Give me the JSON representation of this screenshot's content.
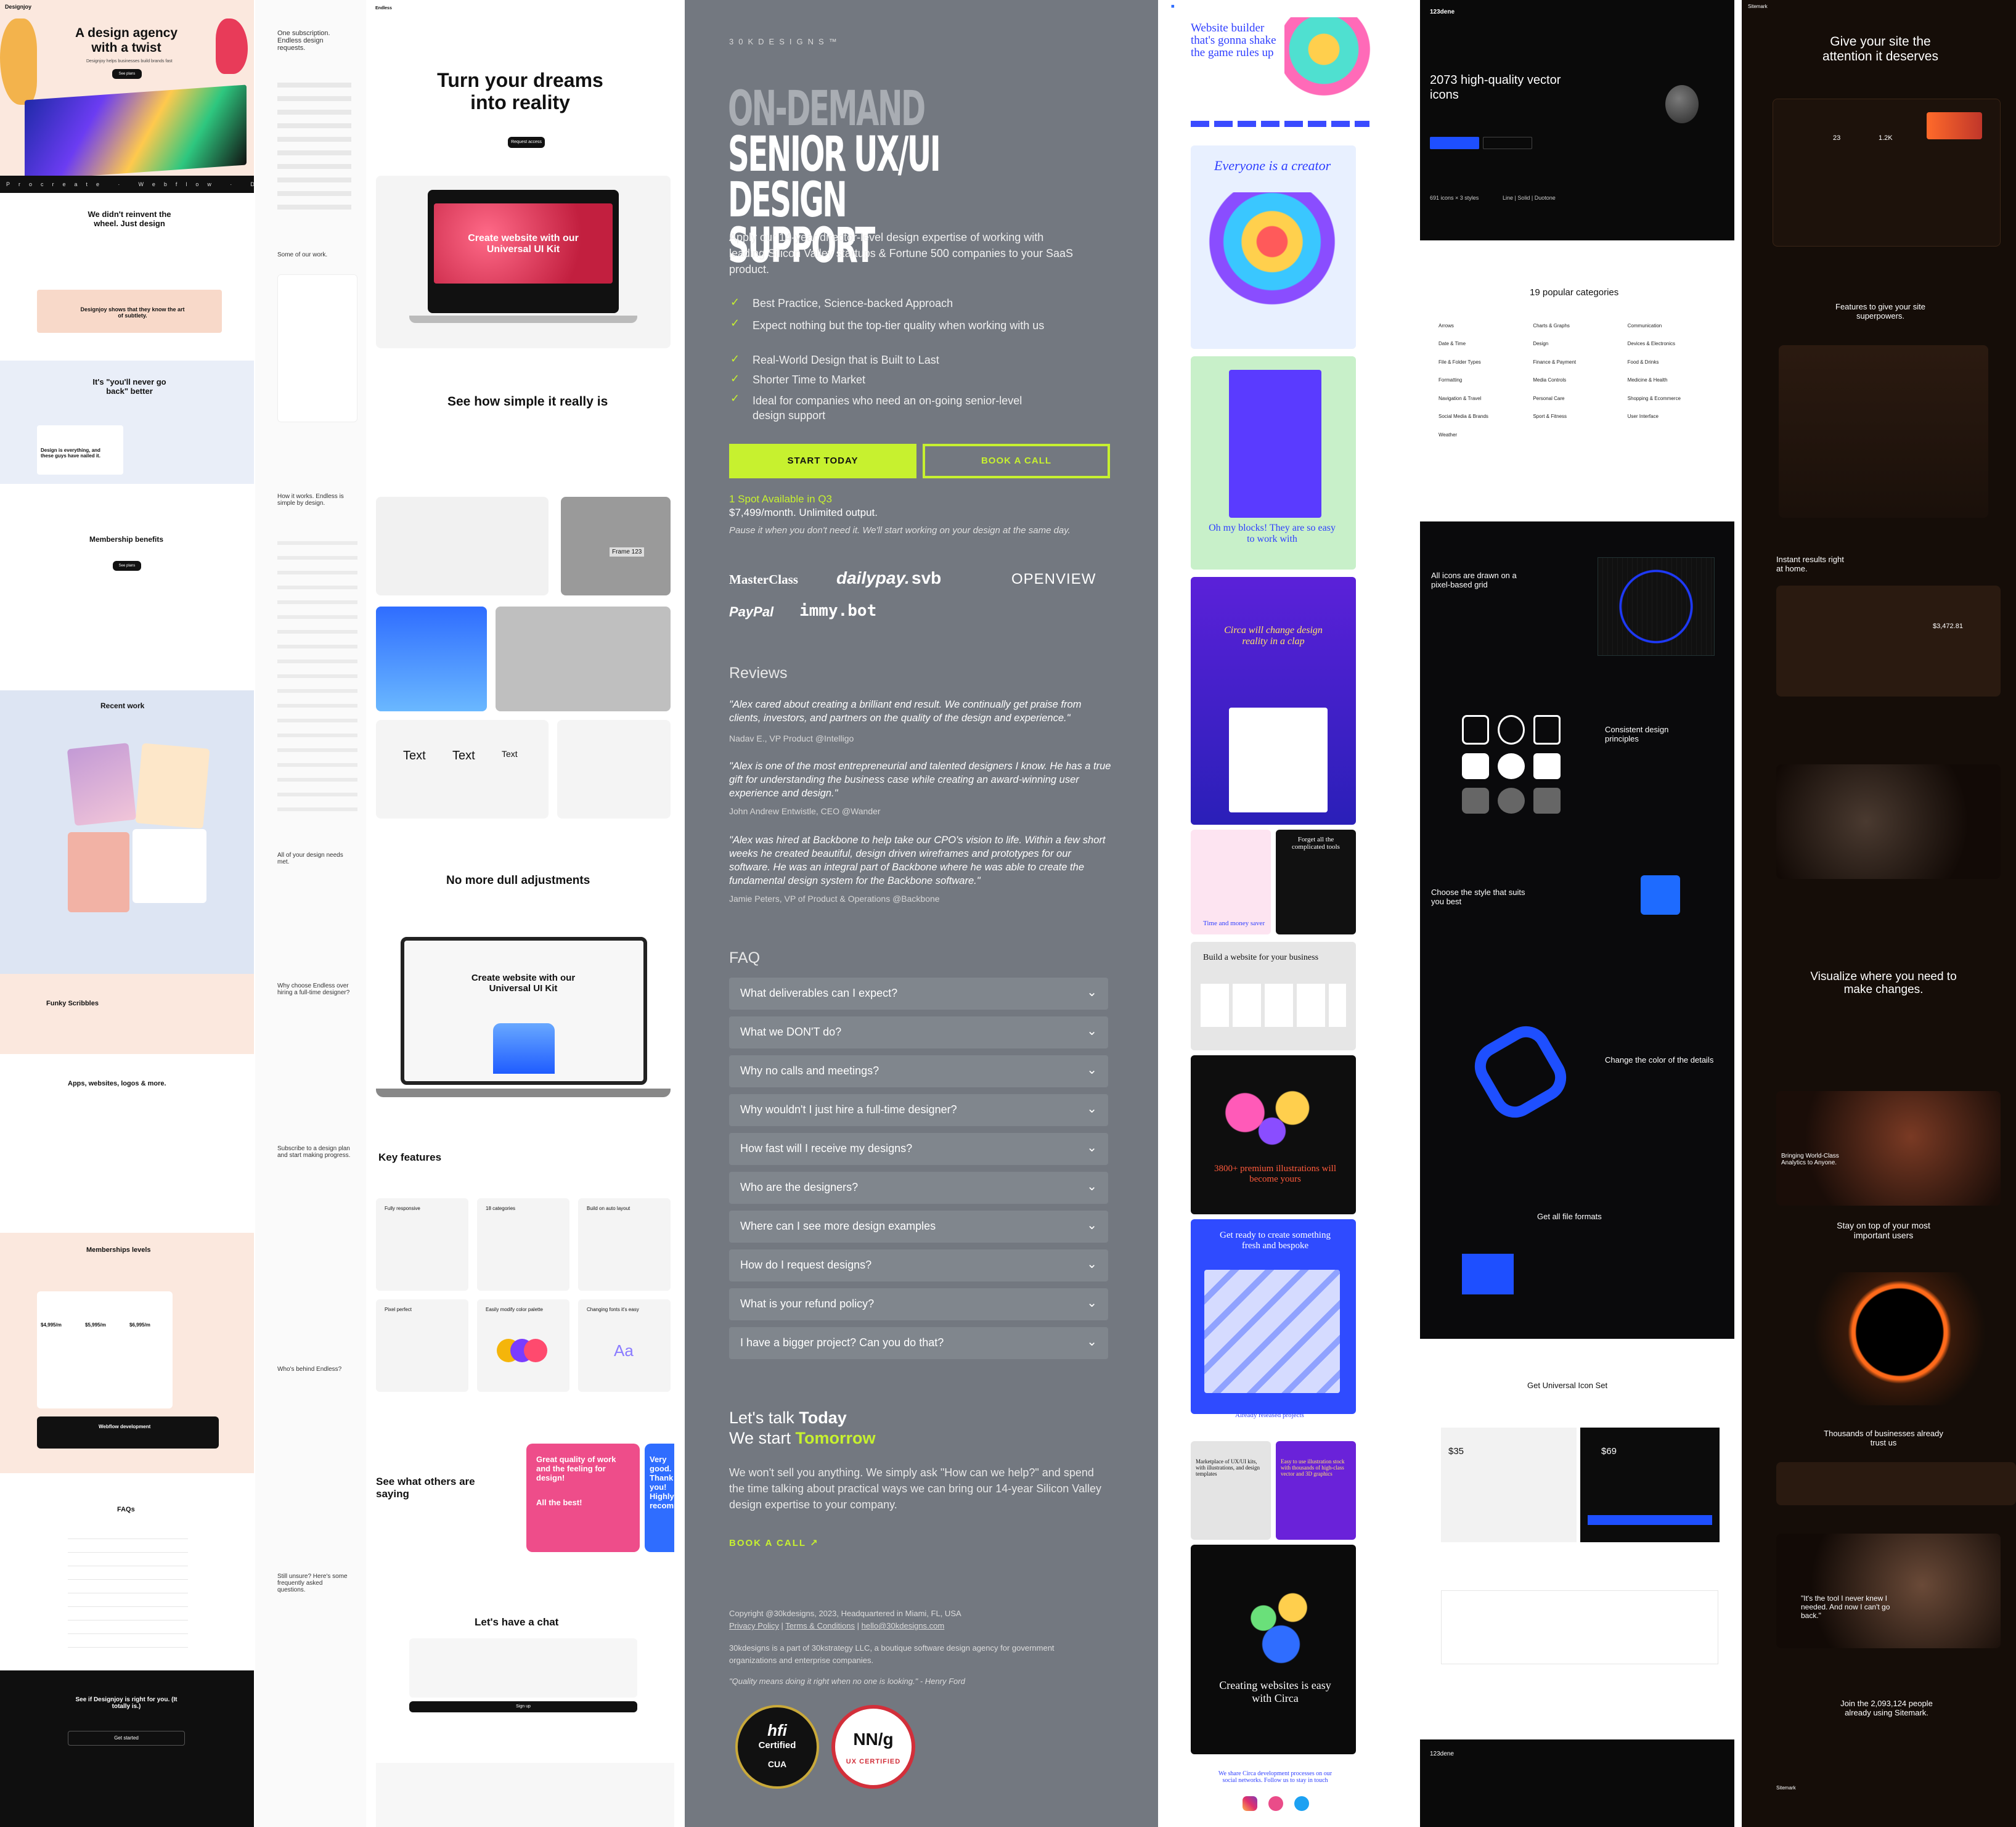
{
  "col1": {
    "hero_title": "A design agency with a twist",
    "hero_sub": "Designjoy helps businesses build brands fast",
    "hero_btn": "See plans",
    "section1": "We didn't reinvent the wheel. Just design",
    "quote1": "Designjoy shows that they know the art of subtlety.",
    "section2": "It's \"you'll never go back\" better",
    "quote2": "Design is everything, and these guys have nailed it.",
    "benefits_title": "Membership benefits",
    "benefits_btn": "See plans",
    "recent_work": "Recent work",
    "scribbles": "Funky Scribbles",
    "apps": "Apps, websites, logos & more.",
    "memberships": "Memberships levels",
    "price1": "$4,995/m",
    "price2": "$5,995/m",
    "price3": "$6,995/m",
    "webflow": "Webflow development",
    "faqs": "FAQs",
    "cta": "See if Designjoy is right for you. (It totally is.)",
    "cta_btn": "Get started",
    "footer_logo": "Designjoy"
  },
  "col2": {
    "sub_title": "One subscription. Endless design requests.",
    "hero_title_1": "Turn your dreams",
    "hero_title_2": "into reality",
    "hero_btn": "Request access",
    "laptop_text": "Create website with our Universal UI Kit",
    "some_work": "Some of our work.",
    "simple_title": "See how simple it really is",
    "how_works": "How it works. Endless is simple by design.",
    "dull_title": "No more dull adjustments",
    "needs": "All of your design needs met.",
    "why_endless": "Why choose Endless over hiring a full-time designer?",
    "laptop2_text": "Create website with our Universal UI Kit",
    "key_features": "Key features",
    "subscribe": "Subscribe to a design plan and start making progress.",
    "feat1": "Fully responsive",
    "feat2": "18 categories",
    "feat3": "Build on auto layout",
    "feat4": "Pixel perfect",
    "feat5": "Easily modify color palette",
    "feat6": "Changing fonts it's easy",
    "feat6_glyph": "Aa",
    "whos_behind": "Who's behind Endless?",
    "see_others": "See what others are saying",
    "testi1": "Great quality of work and the feeling for design!",
    "testi1_b": "All the best!",
    "testi2": "Very good. Thank you! Highly recommend",
    "unsure": "Still unsure? Here's some frequently asked questions.",
    "chat": "Let's have a chat",
    "chat_btn": "Sign up",
    "text_label": "Text",
    "frame_label": "Frame 123"
  },
  "col3": {
    "logo": "30KDESIGNS™",
    "headline_a": "ON-DEMAND",
    "headline_b": "SENIOR UX/UI",
    "headline_c": "DESIGN SUPPORT",
    "intro": "Apply our 14-year director-level design expertise of working with leading Silicon Valley startups & Fortune 500 companies to your SaaS product.",
    "bullets": [
      "Best Practice, Science-backed Approach",
      "Expect nothing but the top-tier quality when working with us",
      "Real-World Design that is Built to Last",
      "Shorter Time to Market",
      "Ideal for companies who need an on-going senior-level design support"
    ],
    "btn_start": "START TODAY",
    "btn_call": "BOOK A CALL",
    "availability": "1 Spot Available in Q3",
    "price": "$7,499/month. Unlimited output.",
    "pause": "Pause it when you don't need it. We'll start working on your design at the same day.",
    "logos": [
      "MasterClass",
      "dailypay.",
      "svb",
      "OPENVIEW",
      "PayPal",
      "immy.bot"
    ],
    "reviews_title": "Reviews",
    "reviews": [
      {
        "text": "\"Alex cared about creating a brilliant end result. We continually get praise from clients, investors, and partners on the quality of the design and experience.\"",
        "author": "Nadav E., VP Product @Intelligo"
      },
      {
        "text": "\"Alex is one of the most entrepreneurial and talented designers I know. He has a true gift for understanding the business case while creating an award-winning user experience and design.\"",
        "author": "John Andrew Entwistle, CEO @Wander"
      },
      {
        "text": "\"Alex was hired at Backbone to help take our CPO's vision to life. Within a few short weeks he created beautiful, design driven wireframes and prototypes for our software. He was an integral part of Backbone where he was able to create the fundamental design system for the Backbone software.\"",
        "author": "Jamie Peters, VP of Product & Operations @Backbone"
      }
    ],
    "faq_title": "FAQ",
    "faq": [
      "What deliverables can I expect?",
      "What we DON'T do?",
      "Why no calls and meetings?",
      "Why wouldn't I just hire a full-time designer?",
      "How fast will I receive my designs?",
      "Who are the designers?",
      "Where can I see more design examples",
      "How do I request designs?",
      "What is your refund policy?",
      "I have a bigger project? Can you do that?"
    ],
    "talk_a": "Let's talk",
    "talk_b": "Today",
    "start_a": "We start",
    "start_b": "Tomorrow",
    "talk_body": "We won't sell you anything. We simply ask \"How can we help?\" and spend the time talking about practical ways we can bring our 14-year Silicon Valley design expertise to your company.",
    "book_link": "BOOK A CALL ↗",
    "copyright": "Copyright @30kdesigns, 2023, Headquartered in Miami, FL, USA",
    "footer_links": [
      "Privacy Policy",
      "Terms & Conditions",
      "hello@30kdesigns.com"
    ],
    "part_of": "30kdesigns is a part of 30kstrategy LLC, a boutique software design agency for government organizations and enterprise companies.",
    "quote": "\"Quality means doing it right when no one is looking.\" - Henry Ford",
    "badge1_a": "hfi",
    "badge1_b": "Certified",
    "badge1_c": "CUA",
    "badge2_a": "NN/g",
    "badge2_b": "UX CERTIFIED",
    "colors": {
      "accent": "#c7f12f",
      "bg": "#737880"
    }
  },
  "col4": {
    "hero_title": "Website builder that's gonna shake the game rules up",
    "creator": "Everyone is a creator",
    "blocks": "Oh my blocks! They are so easy to work with",
    "circa": "Circa will change design reality in a clap",
    "feature_a": "Forget all the complicated tools",
    "feature_b": "Time and money saver",
    "build_title": "Build a website for your business",
    "illustrations": "3800+ premium illustrations will become yours",
    "ready": "Get ready to create something fresh and bespoke",
    "released": "Already released projects",
    "marketplace": "Marketplace of UX/UI kits, with illustrations, and design templates",
    "easy": "Easy to use illustration stock with thousands of high-class vector and 3D graphics",
    "creating": "Creating websites is easy with Circa",
    "share": "We share Circa development processes on our social networks. Follow us to stay in touch"
  },
  "col5": {
    "hero_title": "2073 high-quality vector icons",
    "brand": "123dene",
    "stat1": "691 icons × 3 styles",
    "stat2": "Line | Solid | Duotone",
    "categories_title": "19 popular categories",
    "categories": [
      "Arrows",
      "Charts & Graphs",
      "Communication",
      "Date & Time",
      "Design",
      "Devices & Electronics",
      "File & Folder Types",
      "Finance & Payment",
      "Food & Drinks",
      "Formatting",
      "Media Controls",
      "Medicine & Health",
      "Navigation & Travel",
      "Personal Care",
      "Shopping & Ecommerce",
      "Social Media & Brands",
      "Sport & Fitness",
      "User Interface",
      "Weather"
    ],
    "pixel_grid": "All icons are drawn on a pixel-based grid",
    "consistent": "Consistent design principles",
    "style": "Choose the style that suits you best",
    "color": "Change the color of the details",
    "formats": "Get all file formats",
    "get_set": "Get Universal Icon Set",
    "price1": "$35",
    "price2": "$69",
    "footer_brand": "123dene"
  },
  "col6": {
    "brand": "Sitemark",
    "hero_title": "Give your site the attention it deserves",
    "features": "Features to give your site superpowers.",
    "instant": "Instant results right at home.",
    "stat1": "23",
    "stat2": "1.2K",
    "stat3": "$3,472.81",
    "visualize": "Visualize where you need to make changes.",
    "analytics": "Bringing World-Class Analytics to Anyone.",
    "stay": "Stay on top of your most important users",
    "thousands": "Thousands of businesses already trust us",
    "quote": "\"It's the tool I never knew I needed. And now I can't go back.\"",
    "join": "Join the 2,093,124 people already using Sitemark."
  }
}
